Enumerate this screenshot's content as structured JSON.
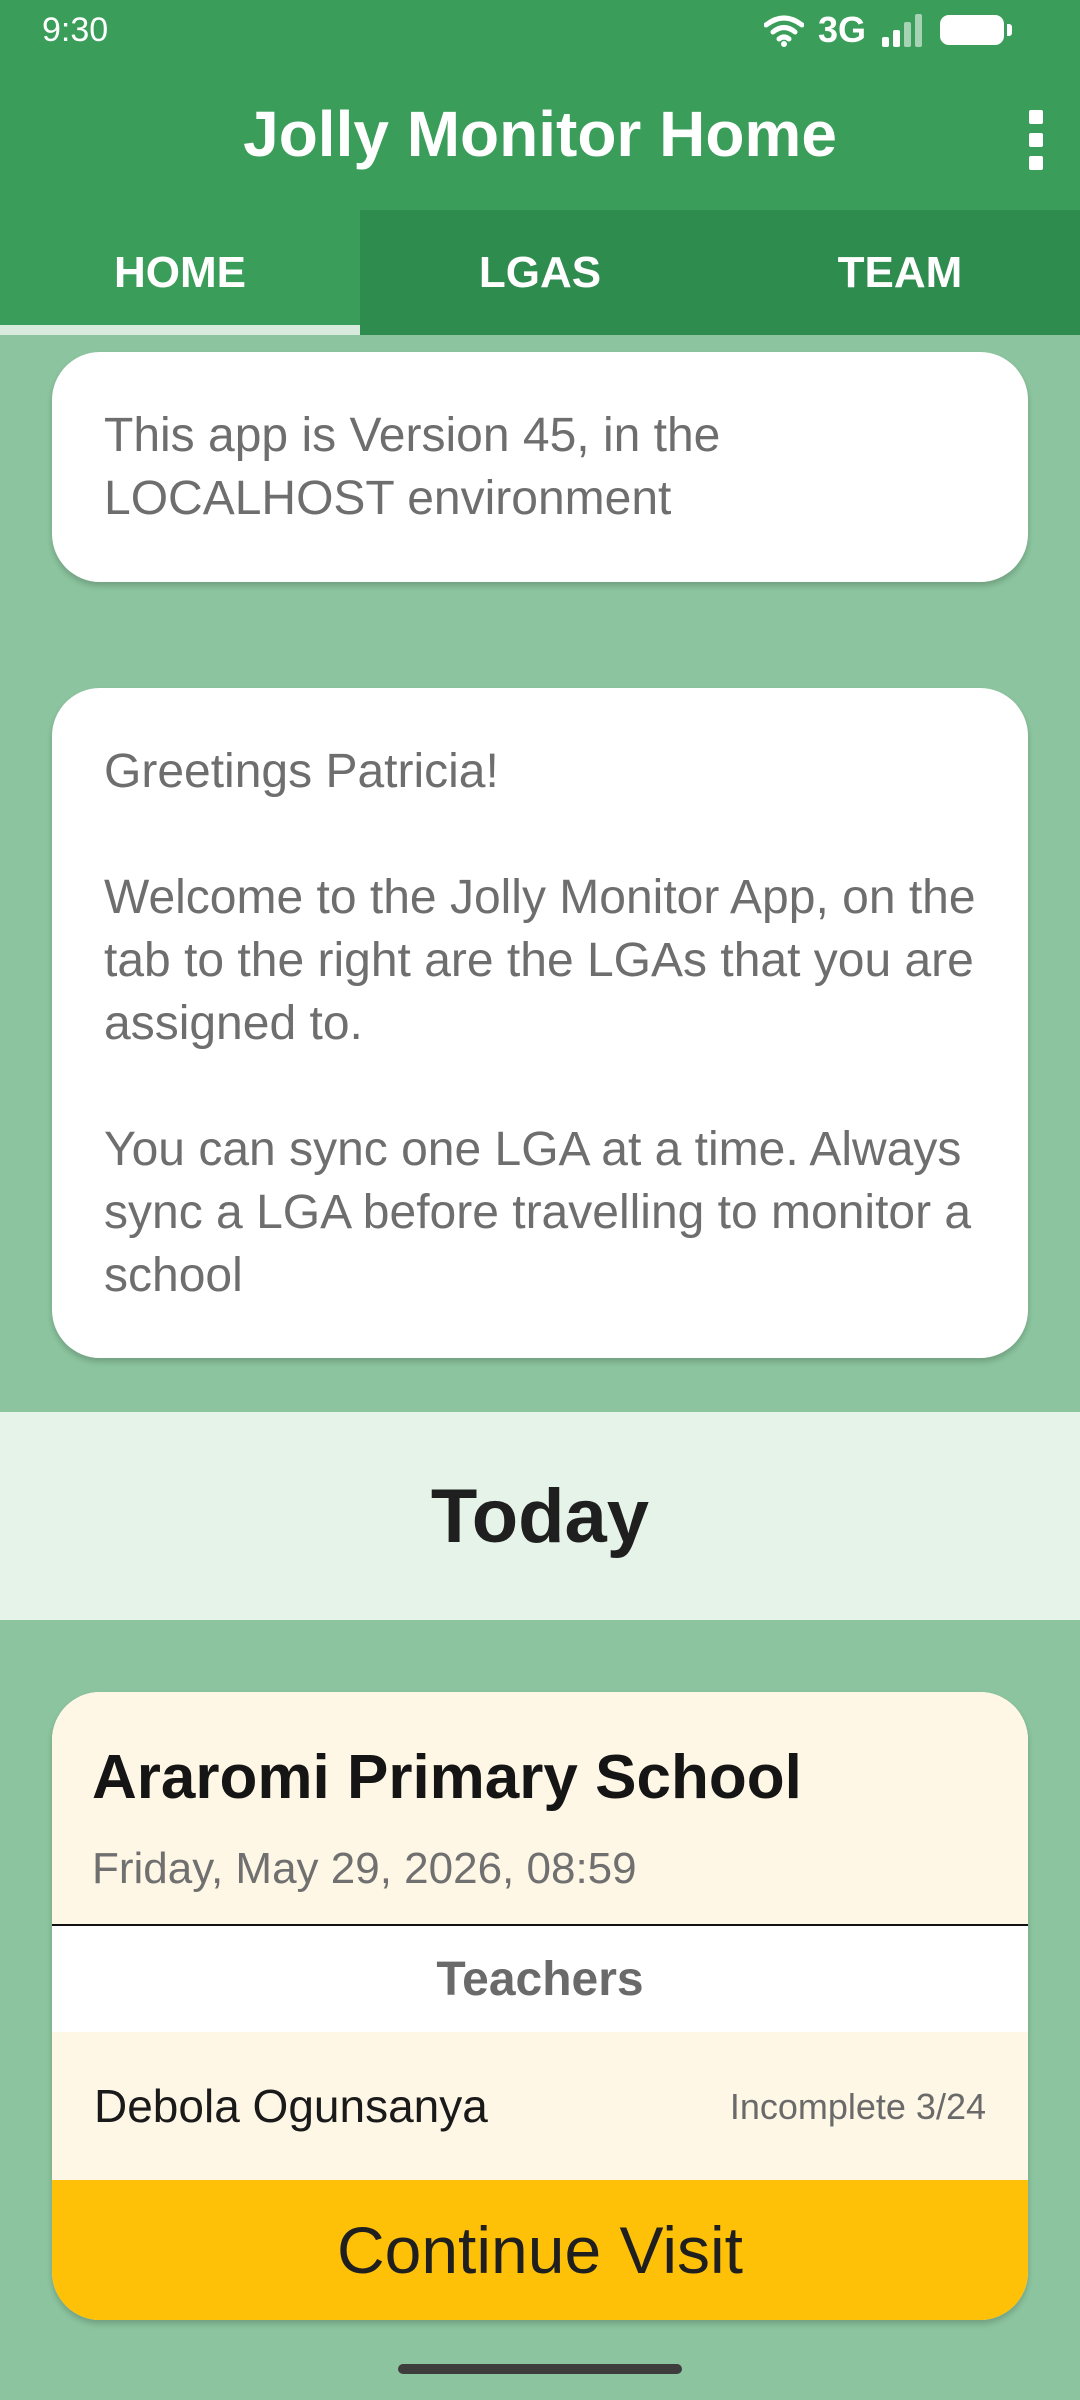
{
  "status_bar": {
    "time": "9:30",
    "network": "3G",
    "icons": [
      "wifi-icon",
      "signal-icon",
      "battery-icon"
    ]
  },
  "app_bar": {
    "title": "Jolly Monitor Home",
    "menu_icon": "more-vert-icon"
  },
  "tabs": [
    {
      "label": "HOME",
      "active": true
    },
    {
      "label": "LGAS",
      "active": false
    },
    {
      "label": "TEAM",
      "active": false
    }
  ],
  "info_card": {
    "text": "This app is Version 45, in the LOCALHOST environment"
  },
  "welcome_card": {
    "greeting": "Greetings Patricia!",
    "paragraph1": "Welcome to the Jolly Monitor App, on the tab to the right are the LGAs that you are assigned to.",
    "paragraph2": "You can sync one LGA at a time. Always sync a LGA before travelling to monitor a school"
  },
  "today": {
    "title": "Today"
  },
  "visit": {
    "school": "Araromi Primary School",
    "datetime": "Friday, May 29, 2026, 08:59",
    "teachers_label": "Teachers",
    "teachers": [
      {
        "name": "Debola Ogunsanya",
        "status": "Incomplete 3/24"
      }
    ],
    "continue_label": "Continue Visit"
  },
  "colors": {
    "primary": "#3a9e5a",
    "primary_dark": "#2f8c4f",
    "background": "#8bc49e",
    "accent": "#ffc107",
    "card_tint": "#fff7e6",
    "band": "#e6f3e9"
  }
}
